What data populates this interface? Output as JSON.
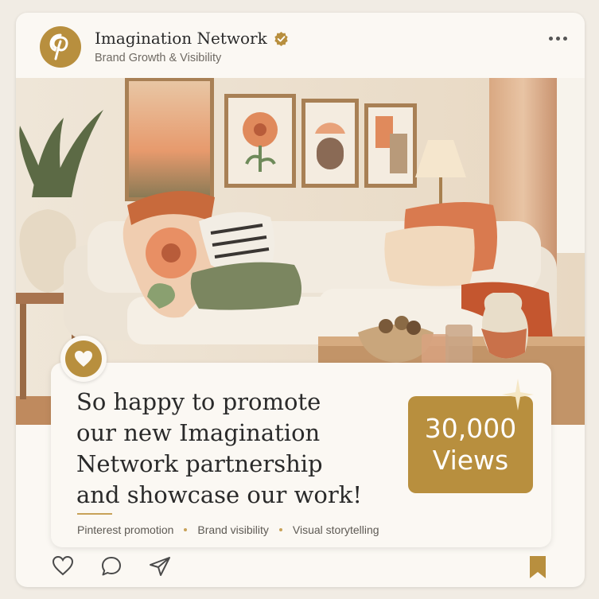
{
  "header": {
    "account_name": "Imagination Network",
    "account_subtitle": "Brand Growth & Visibility"
  },
  "post": {
    "headline": "So happy to promote\nour new Imagination\nNetwork partnership\nand showcase our work!",
    "tags": [
      "Pinterest promotion",
      "Brand visibility",
      "Visual storytelling"
    ],
    "views_line1": "30,000",
    "views_line2": "Views"
  },
  "icons": {
    "avatar": "pinterest-logo-icon",
    "verified": "verified-badge-icon",
    "more": "more-options-icon",
    "badge": "heart-icon",
    "like": "heart-outline-icon",
    "comment": "comment-icon",
    "share": "send-icon",
    "save": "bookmark-icon"
  },
  "colors": {
    "accent": "#b88f3e",
    "card": "#fbf8f3",
    "text": "#2a2a2a"
  }
}
